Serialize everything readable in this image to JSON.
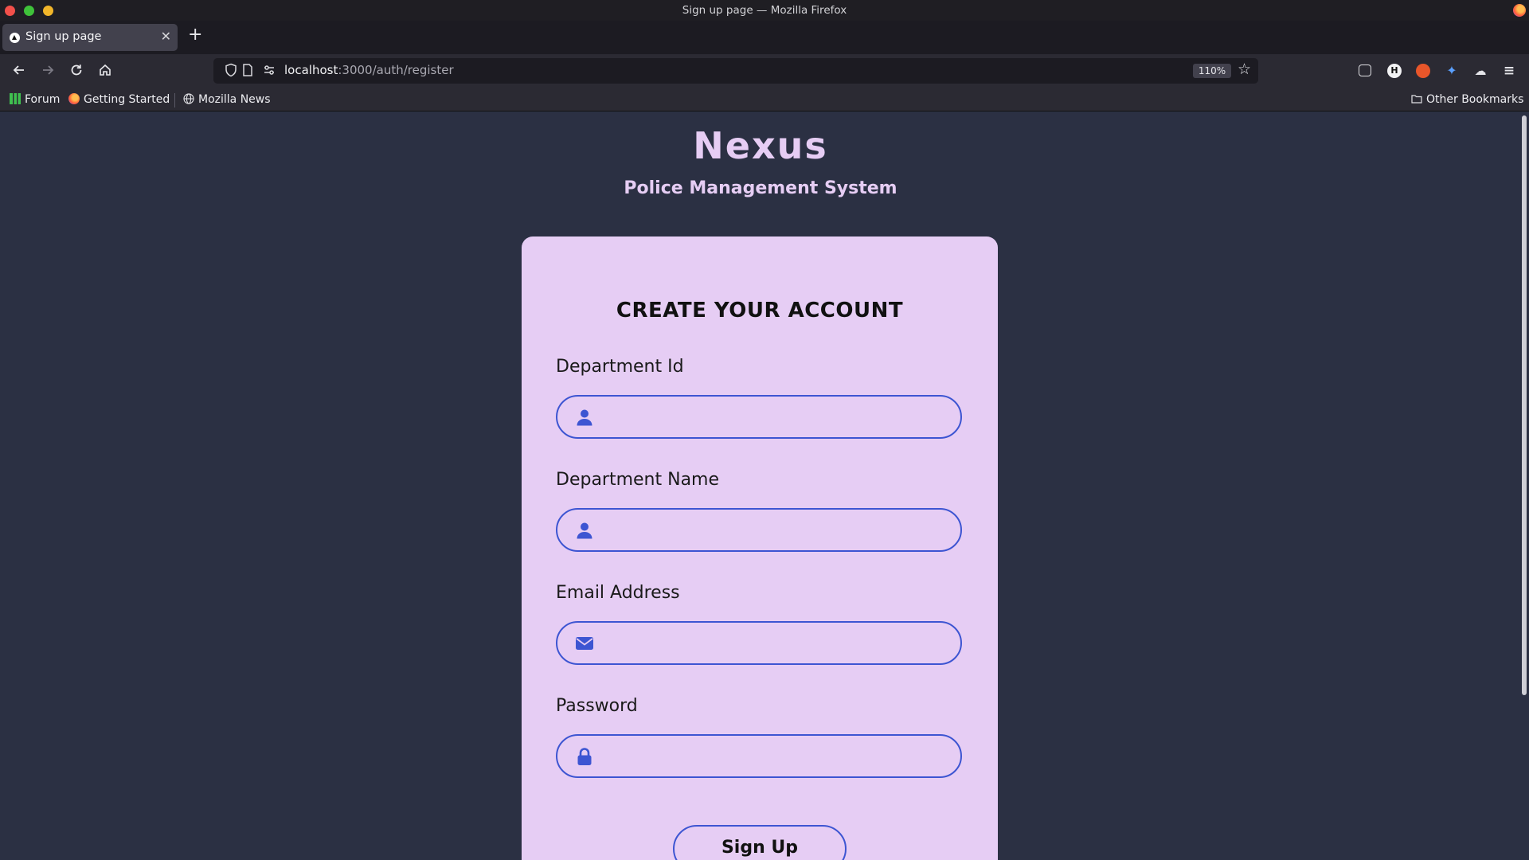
{
  "window": {
    "title": "Sign up page — Mozilla Firefox"
  },
  "tabs": [
    {
      "label": "Sign up page",
      "active": true
    }
  ],
  "urlbar": {
    "host": "localhost",
    "path": ":3000/auth/register",
    "zoom": "110%"
  },
  "bookmarks": {
    "items": [
      {
        "label": "Forum"
      },
      {
        "label": "Getting Started"
      },
      {
        "label": "Mozilla News"
      }
    ],
    "other": "Other Bookmarks"
  },
  "page": {
    "brand": "Nexus",
    "subtitle": "Police Management System",
    "form": {
      "heading": "CREATE YOUR ACCOUNT",
      "fields": [
        {
          "label": "Department Id",
          "icon": "user-icon",
          "value": "",
          "type": "text"
        },
        {
          "label": "Department Name",
          "icon": "user-icon",
          "value": "",
          "type": "text"
        },
        {
          "label": "Email Address",
          "icon": "envelope-icon",
          "value": "",
          "type": "email"
        },
        {
          "label": "Password",
          "icon": "lock-icon",
          "value": "",
          "type": "password"
        }
      ],
      "submit_label": "Sign Up"
    }
  },
  "colors": {
    "page_bg": "#2b3043",
    "card_bg": "#e6cdf4",
    "accent": "#3d55d2"
  }
}
